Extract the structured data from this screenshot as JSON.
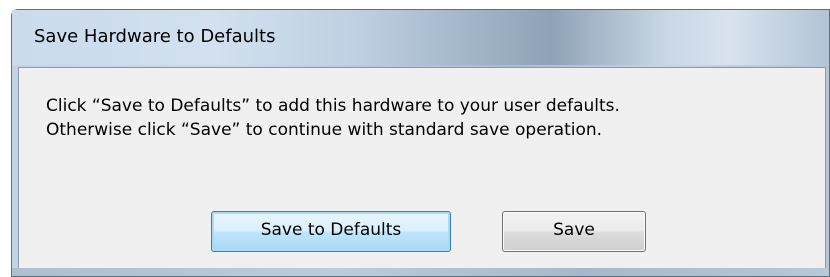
{
  "dialog": {
    "title": "Save Hardware to Defaults",
    "message_lines": [
      "Click “Save to Defaults” to add this hardware to your user defaults.",
      "Otherwise click “Save” to continue with standard save operation."
    ],
    "buttons": {
      "save_to_defaults": "Save to Defaults",
      "save": "Save"
    },
    "default_button": "save_to_defaults"
  },
  "colors": {
    "default_button_border": "#3c7fb1",
    "client_background": "#f0f0f0"
  }
}
